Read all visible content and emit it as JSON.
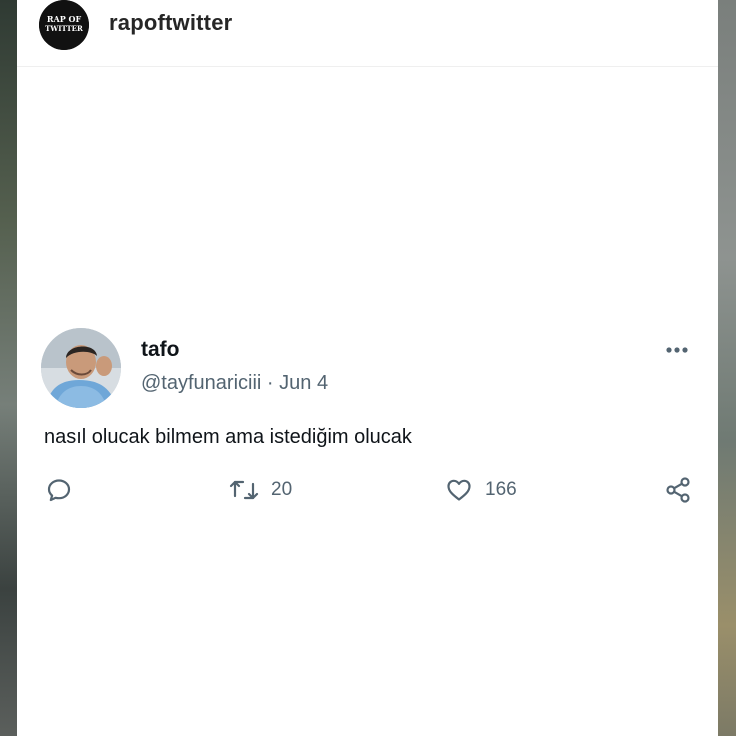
{
  "post": {
    "account_username": "rapoftwitter",
    "avatar_lettering": [
      "RAP OF",
      "TWITTER"
    ]
  },
  "tweet": {
    "display_name": "tafo",
    "handle": "@tayfunariciii",
    "separator": "·",
    "date": "Jun 4",
    "text": "nasıl olucak bilmem ama istediğim olucak",
    "retweet_count": "20",
    "like_count": "166"
  },
  "icons": {
    "reply": "reply-icon",
    "retweet": "retweet-icon",
    "like": "heart-icon",
    "share": "share-icon",
    "more": "more-options-icon"
  },
  "colors": {
    "text_primary": "#0f1419",
    "text_secondary": "#536471",
    "card_background": "#ffffff"
  }
}
